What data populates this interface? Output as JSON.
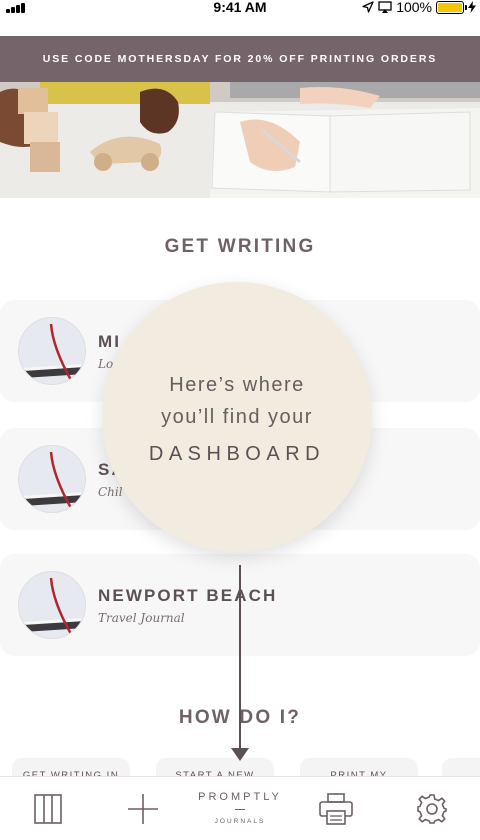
{
  "status_bar": {
    "time": "9:41 AM",
    "battery": "100%"
  },
  "promo": {
    "text": "USE CODE MOTHERSDAY FOR 20% OFF PRINTING ORDERS"
  },
  "sections": {
    "get_writing": "GET WRITING",
    "how_do_i": "HOW DO I?"
  },
  "journals": [
    {
      "title": "MI",
      "subtitle": "Lo",
      "thumb_icon": "journal-book-icon"
    },
    {
      "title": "SA",
      "subtitle": "Chil",
      "thumb_icon": "journal-book-icon"
    },
    {
      "title": "NEWPORT BEACH",
      "subtitle": "Travel Journal",
      "thumb_icon": "journal-book-icon"
    }
  ],
  "tooltip": {
    "line1": "Here’s where",
    "line2": "you’ll find your",
    "line3": "DASHBOARD"
  },
  "how_do_i": [
    {
      "label": "GET WRITING IN"
    },
    {
      "label": "START A NEW"
    },
    {
      "label": "PRINT MY"
    }
  ],
  "tabbar": {
    "brand_name": "PROMPTLY",
    "brand_sub": "JOURNALS",
    "icons": [
      "dashboard-columns-icon",
      "plus-icon",
      "printer-icon",
      "gear-icon"
    ]
  },
  "colors": {
    "banner": "#75646a",
    "tooltip": "#f2ece0",
    "accent_text": "#5d5054",
    "battery": "#f6c600"
  }
}
